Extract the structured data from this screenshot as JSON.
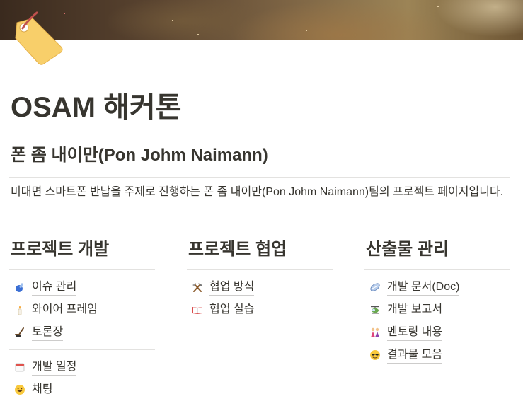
{
  "page": {
    "title": "OSAM 해커톤",
    "team_heading": "폰 좀 내이만(Pon Johm Naimann)",
    "description": "비대면 스마트폰 반납을 주제로 진행하는 폰 좀 내이만(Pon Johm Naimann)팀의 프로젝트 페이지입니다.",
    "icon": "label-tag-icon",
    "cover": "space-nebula-cover"
  },
  "columns": [
    {
      "heading": "프로젝트 개발",
      "groups": [
        [
          {
            "label": "이슈 관리",
            "icon": "test-tube-icon"
          },
          {
            "label": "와이어 프레임",
            "icon": "candle-icon"
          },
          {
            "label": "토론장",
            "icon": "hockey-icon"
          }
        ],
        [
          {
            "label": "개발 일정",
            "icon": "calendar-icon"
          },
          {
            "label": "채팅",
            "icon": "smile-icon"
          }
        ]
      ]
    },
    {
      "heading": "프로젝트 협업",
      "groups": [
        [
          {
            "label": "협업 방식",
            "icon": "hammer-pick-icon"
          },
          {
            "label": "협업 실습",
            "icon": "book-icon"
          }
        ]
      ]
    },
    {
      "heading": "산출물 관리",
      "groups": [
        [
          {
            "label": "개발 문서(Doc)",
            "icon": "rugby-ball-icon"
          },
          {
            "label": "개발 보고서",
            "icon": "helicopter-icon"
          },
          {
            "label": "멘토링 내용",
            "icon": "dancers-icon"
          },
          {
            "label": "결과물 모음",
            "icon": "sunglasses-face-icon"
          }
        ]
      ]
    }
  ]
}
